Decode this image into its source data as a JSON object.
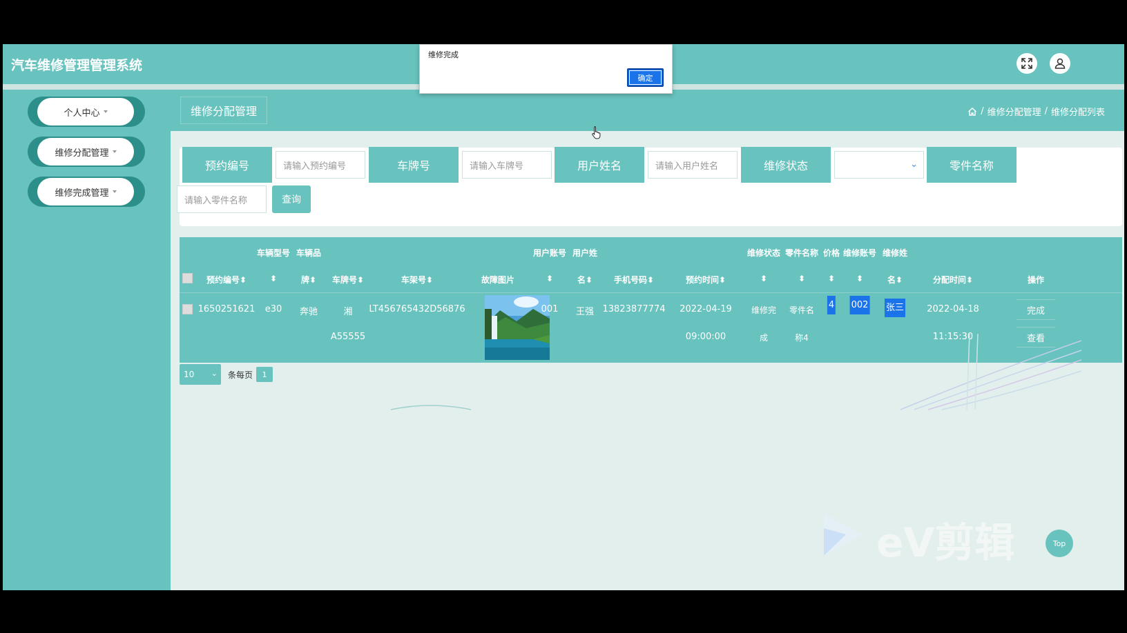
{
  "header": {
    "title": "汽车维修管理管理系统"
  },
  "sidebar": {
    "items": [
      {
        "label": "个人中心"
      },
      {
        "label": "维修分配管理"
      },
      {
        "label": "维修完成管理"
      }
    ]
  },
  "page": {
    "title": "维修分配管理",
    "breadcrumb": [
      "维修分配管理",
      "维修分配列表"
    ],
    "breadcrumb_sep": "/"
  },
  "search": {
    "reservation_label": "预约编号",
    "reservation_placeholder": "请输入预约编号",
    "plate_label": "车牌号",
    "plate_placeholder": "请输入车牌号",
    "username_label": "用户姓名",
    "username_placeholder": "请输入用户姓名",
    "status_label": "维修状态",
    "status_value": "",
    "part_label": "零件名称",
    "part_placeholder": "请输入零件名称",
    "query_button": "查询"
  },
  "table": {
    "headers_top": {
      "vehicle_model": "车辆型号",
      "vehicle_brand": "车辆品",
      "user_account": "用户账号",
      "user_name_top": "用户姓",
      "repair_status": "维修状态",
      "part_name": "零件名称",
      "price": "价格",
      "repair_account": "维修账号",
      "repair_name_top": "维修姓"
    },
    "headers": {
      "reservation_no": "预约编号",
      "brand_tail": "牌",
      "plate": "车牌号",
      "vin": "车架号",
      "fault_image": "故障图片",
      "user_name_tail": "名",
      "phone": "手机号码",
      "reserve_time": "预约时间",
      "repair_name_tail": "名",
      "assign_time": "分配时间",
      "action": "操作"
    },
    "sort_glyph": "⬍",
    "rows": [
      {
        "reservation_no": "1650251621",
        "model": "e30",
        "brand": "奔驰",
        "plate_line1": "湘",
        "plate_line2": "A55555",
        "vin": "LT456765432D56876",
        "user_account": "001",
        "user_name": "王强",
        "phone": "13823877774",
        "reserve_date": "2022-04-19",
        "reserve_time": "09:00:00",
        "status_line1": "维修完",
        "status_line2": "成",
        "part_line1": "零件名",
        "part_line2": "称4",
        "price": "4",
        "repair_account": "002",
        "repair_name": "张三",
        "assign_date": "2022-04-18",
        "assign_time": "11:15:30",
        "action_complete": "完成",
        "action_view": "查看"
      }
    ]
  },
  "pager": {
    "page_size": "10",
    "per_page_label": "条每页",
    "current_page": "1"
  },
  "dialog": {
    "message": "维修完成",
    "ok_label": "确定"
  },
  "overlay": {
    "top_button": "Top",
    "watermark": "eV剪辑"
  },
  "colors": {
    "primary": "#68c2be",
    "dark": "#2c8f8a",
    "selection": "#1a73e8"
  }
}
